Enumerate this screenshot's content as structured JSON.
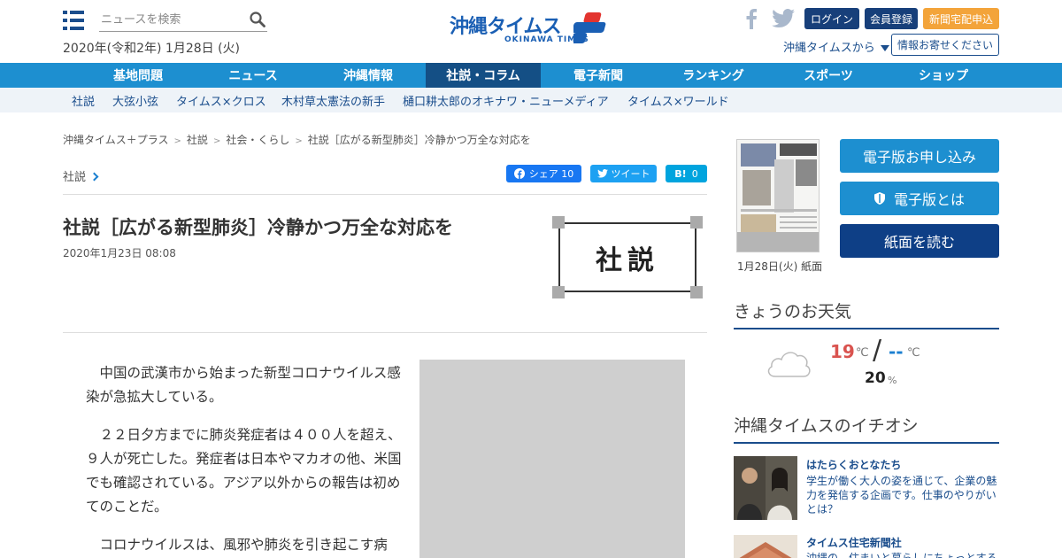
{
  "header": {
    "search_placeholder": "ニュースを検索",
    "date": "2020年(令和2年) 1月28日 (火)",
    "logo_jp": "沖縄タイムス",
    "logo_plus": "プラス",
    "logo_en": "OKINAWA TIMES",
    "login": "ログイン",
    "register": "会員登録",
    "delivery": "新聞宅配申込",
    "from_okinawa": "沖縄タイムスから",
    "send_info": "情報お寄せください"
  },
  "nav": {
    "items": [
      "基地問題",
      "ニュース",
      "沖縄情報",
      "社説・コラム",
      "電子新聞",
      "ランキング",
      "スポーツ",
      "ショップ"
    ],
    "active_index": 3
  },
  "subnav": {
    "items": [
      "社説",
      "大弦小弦",
      "タイムス×クロス",
      "木村草太憲法の新手",
      "樋口耕太郎のオキナワ・ニューメディア",
      "タイムス×ワールド"
    ]
  },
  "breadcrumb": [
    "沖縄タイムス＋プラス",
    "社説",
    "社会・くらし",
    "社説［広がる新型肺炎］冷静かつ万全な対応を"
  ],
  "article": {
    "category": "社説",
    "share_fb": "シェア 10",
    "share_tw": "ツイート",
    "share_hb": "0",
    "title": "社説［広がる新型肺炎］冷静かつ万全な対応を",
    "date": "2020年1月23日 08:08",
    "badge": "社説",
    "paragraphs": [
      "中国の武漢市から始まった新型コロナウイルス感染が急拡大している。",
      "２２日夕方までに肺炎発症者は４００人を超え、９人が死亡した。発症者は日本やマカオの他、米国でも確認されている。アジア以外からの報告は初めてのことだ。",
      "コロナウイルスは、風邪や肺炎を引き起こす病"
    ]
  },
  "sidebar": {
    "paper_caption": "1月28日(火) 紙面",
    "btn_subscribe": "電子版お申し込み",
    "btn_about": "電子版とは",
    "btn_read": "紙面を読む",
    "weather_heading": "きょうのお天気",
    "temp_high": "19",
    "temp_low": "--",
    "temp_unit": "℃",
    "rain": "20",
    "rain_unit": "%",
    "pick_heading": "沖縄タイムスのイチオシ",
    "pick1_title": "はたらくおとなたち",
    "pick1_desc": "学生が働く大人の姿を通じて、企業の魅力を発信する企画です。仕事のやりがいとは？",
    "pick2_title": "タイムス住宅新聞社",
    "pick2_desc": "沖縄の、住まいと暮らしにちょっとする"
  },
  "colors": {
    "nav_bg": "#1d8fd0",
    "nav_active": "#144f85",
    "brand": "#1a4d8c",
    "delivery": "#f3a43a"
  }
}
